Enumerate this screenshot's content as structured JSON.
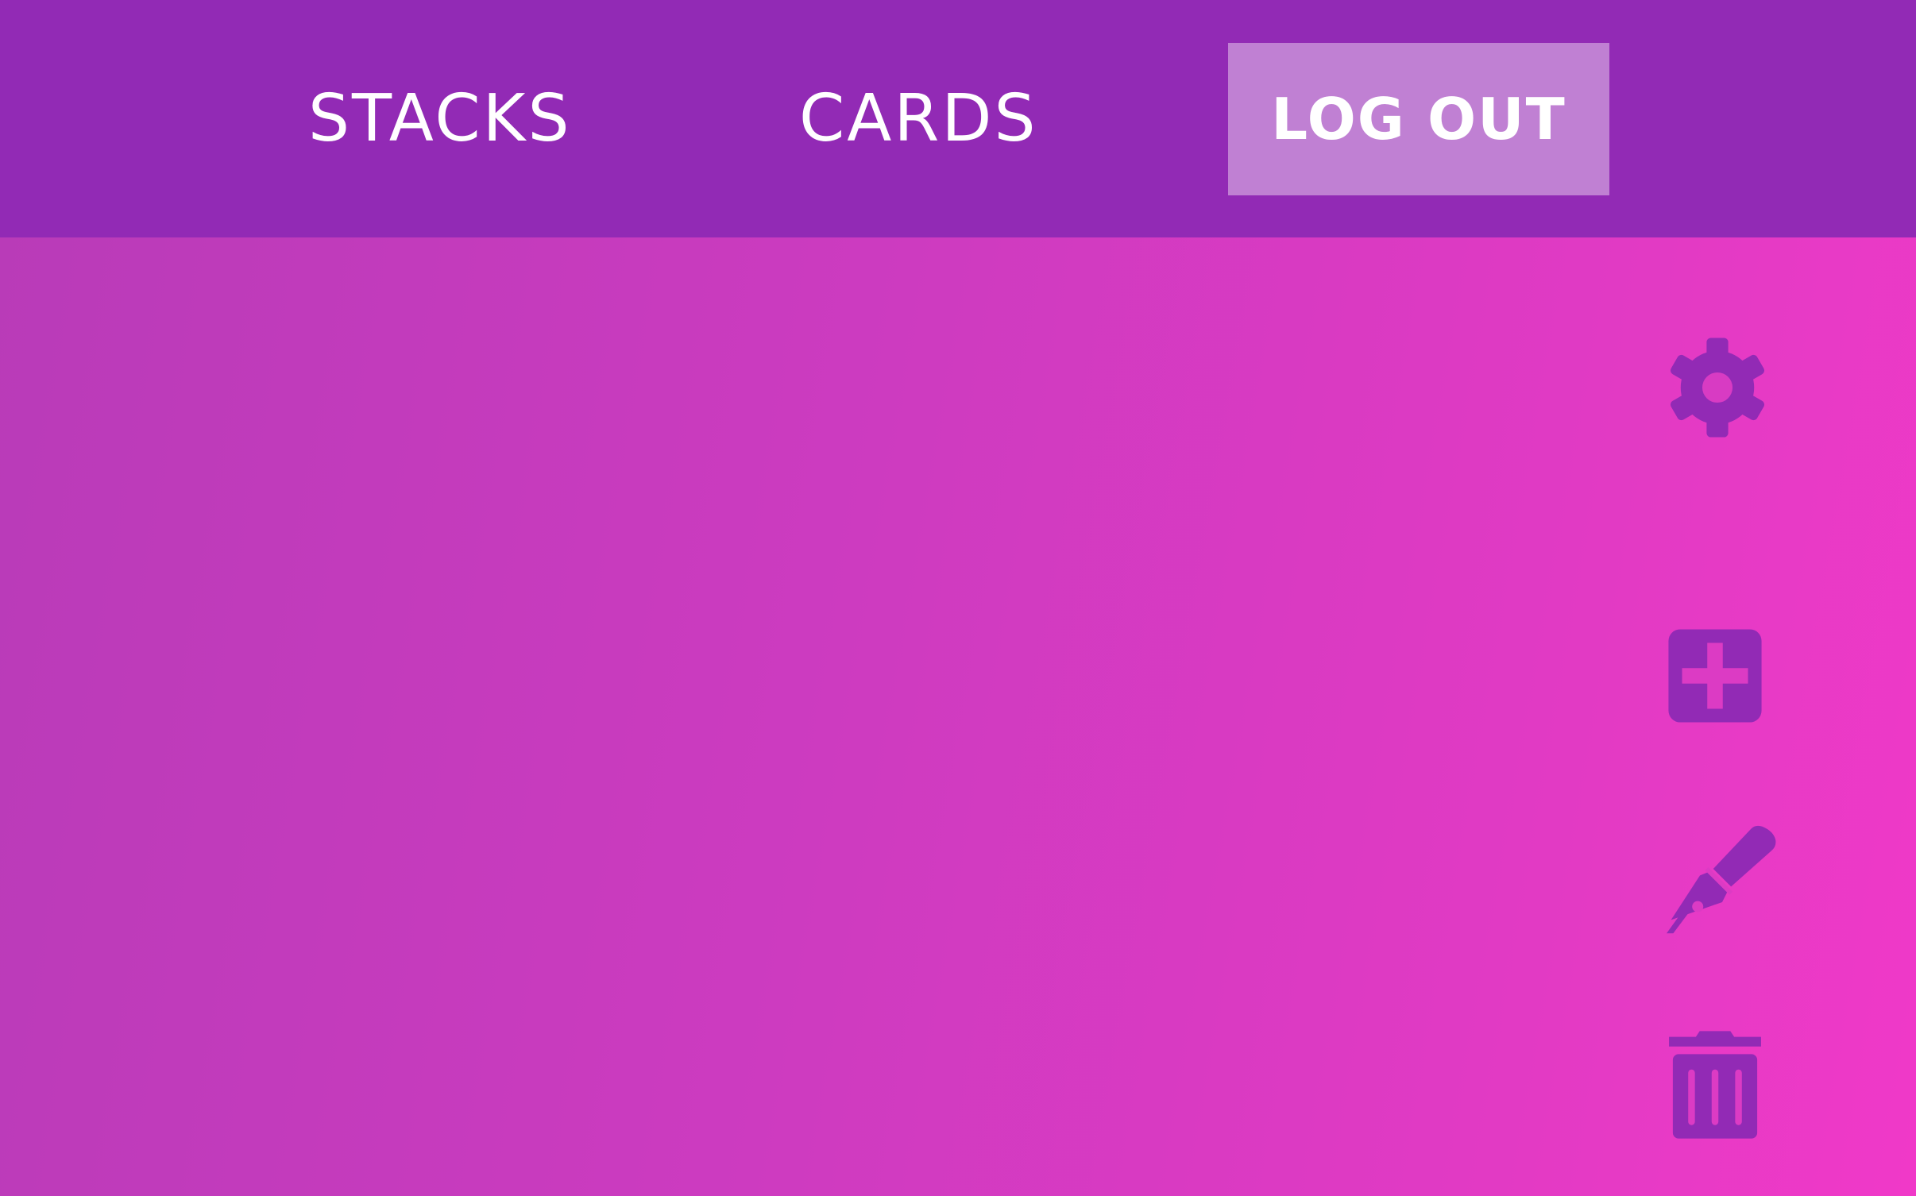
{
  "nav": {
    "stacks_label": "STACKS",
    "cards_label": "CARDS",
    "logout_label": "LOG OUT"
  },
  "toolbar": {
    "icons": [
      "gear-icon",
      "add-icon",
      "pen-icon",
      "trash-icon"
    ]
  },
  "colors": {
    "header_bg": "#922ab5",
    "logout_bg": "#c080d3",
    "icon_color": "#922ab5",
    "gradient_start": "#b83bb8",
    "gradient_end": "#f039c8"
  }
}
